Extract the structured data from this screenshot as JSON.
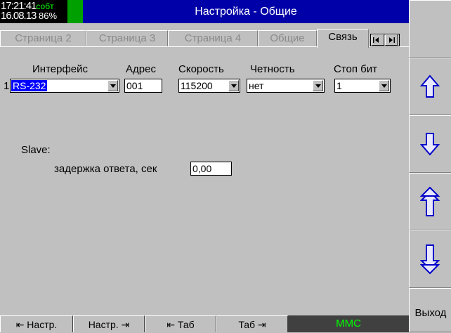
{
  "clock": {
    "time": "17:21:41",
    "mode": "собт",
    "date": "16.08.13",
    "level": "86%"
  },
  "title": "Настройка - Общие",
  "tabs": [
    {
      "label": "Страница 2"
    },
    {
      "label": "Страница 3"
    },
    {
      "label": "Страница 4"
    },
    {
      "label": "Общие"
    },
    {
      "label": "Связь"
    }
  ],
  "headers": {
    "interface": "Интерфейс",
    "address": "Адрес",
    "speed": "Скорость",
    "parity": "Четность",
    "stopbits": "Стоп бит"
  },
  "row": {
    "index": "1",
    "interface": "RS-232",
    "address": "001",
    "speed": "115200",
    "parity": "нет",
    "stopbits": "1"
  },
  "slave": {
    "label": "Slave:",
    "delay_label": "задержка ответа, сек",
    "delay_value": "0,00"
  },
  "right": {
    "exit": "Выход"
  },
  "bottom": {
    "prev_settings": "⇤ Настр.",
    "next_settings": "Настр. ⇥",
    "prev_tab": "⇤ Таб",
    "next_tab": "Таб ⇥",
    "storage": "MMC"
  },
  "icons": [
    "tab-left-icon",
    "tab-right-icon",
    "arrow-up-icon",
    "arrow-down-icon",
    "double-arrow-up-icon",
    "double-arrow-down-icon",
    "dropdown-arrow-icon"
  ],
  "colors": {
    "title_bg": "#0000a8",
    "status_green": "#00a000",
    "selection": "#0000ff",
    "mmc_text": "#00ff00",
    "background": "#c0c0c0"
  }
}
